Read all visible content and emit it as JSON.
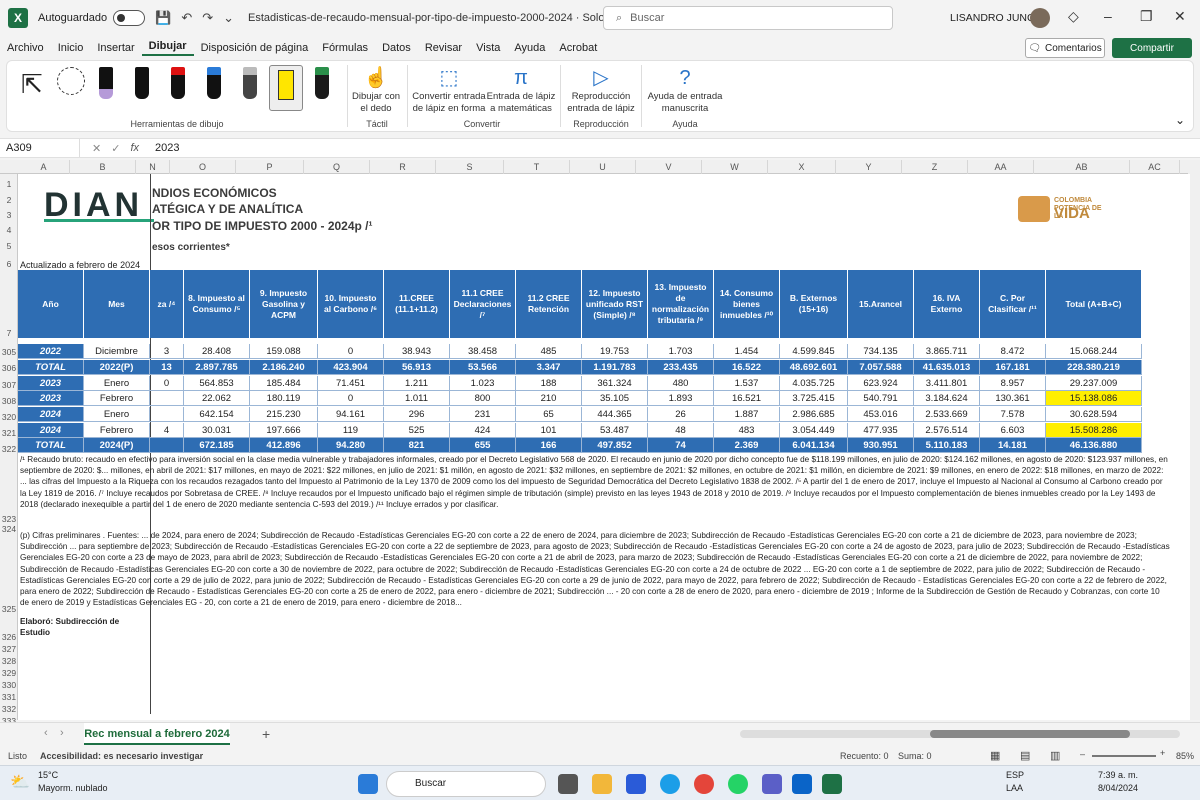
{
  "window": {
    "app_letter": "X",
    "autosave_label": "Autoguardado",
    "filename": "Estadisticas-de-recaudo-mensual-por-tipo-de-impuesto-2000-2024 · Solo lec...",
    "search_placeholder": "Buscar",
    "user": "LISANDRO JUNCO"
  },
  "menu": [
    "Archivo",
    "Inicio",
    "Insertar",
    "Dibujar",
    "Disposición de página",
    "Fórmulas",
    "Datos",
    "Revisar",
    "Vista",
    "Ayuda",
    "Acrobat"
  ],
  "menu_active": "Dibujar",
  "buttons": {
    "comments": "Comentarios",
    "share": "Compartir"
  },
  "ribbon": {
    "group_tools": "Herramientas de dibujo",
    "draw_finger": "Dibujar con el dedo",
    "group_touch": "Táctil",
    "ink_to_shape": "Convertir entrada de lápiz en forma",
    "ink_to_math": "Entrada de lápiz a matemáticas",
    "group_convert": "Convertir",
    "replay": "Reproducción entrada de lápiz",
    "group_replay": "Reproducción",
    "help_ink": "Ayuda de entrada manuscrita",
    "group_help": "Ayuda"
  },
  "formula": {
    "cell": "A309",
    "value": "2023",
    "fx": "fx"
  },
  "columns": [
    "A",
    "B",
    "N",
    "O",
    "P",
    "Q",
    "R",
    "S",
    "T",
    "U",
    "V",
    "W",
    "X",
    "Y",
    "Z",
    "AA",
    "AB",
    "AC"
  ],
  "rows": [
    "1",
    "2",
    "3",
    "4",
    "5",
    "6",
    "7",
    "305",
    "306",
    "307",
    "308",
    "320",
    "321",
    "322",
    "323",
    "324",
    "325",
    "326",
    "327",
    "328",
    "329",
    "330",
    "331",
    "332",
    "333"
  ],
  "sheet": {
    "logo_text": "DIAN",
    "title1": "NDIOS ECONÓMICOS",
    "title2": "ATÉGICA Y DE ANALÍTICA",
    "title3": "OR TIPO DE IMPUESTO 2000 - 2024p /¹",
    "subtitle": "esos corrientes*",
    "updated": "Actualizado a febrero de 2024",
    "brand_small": "COLOMBIA POTENCIA DE LA",
    "brand_big": "VIDA"
  },
  "table": {
    "headers": [
      "Año",
      "Mes",
      "za /⁴",
      "8. Impuesto al Consumo /⁵",
      "9. Impuesto Gasolina y ACPM",
      "10. Impuesto al Carbono /⁶",
      "11.CREE (11.1+11.2)",
      "11.1 CREE Declaraciones /⁷",
      "11.2 CREE Retención",
      "12. Impuesto unificado RST (Simple) /⁸",
      "13. Impuesto de normalización tributaria /⁹",
      "14. Consumo bienes inmuebles /¹⁰",
      "B. Externos (15+16)",
      "15.Arancel",
      "16. IVA Externo",
      "C. Por Clasificar /¹¹",
      "Total (A+B+C)"
    ],
    "rows": [
      {
        "style": "white",
        "cells": [
          "2022",
          "Diciembre",
          "3",
          "28.408",
          "159.088",
          "0",
          "38.943",
          "38.458",
          "485",
          "19.753",
          "1.703",
          "1.454",
          "4.599.845",
          "734.135",
          "3.865.711",
          "8.472",
          "15.068.244"
        ]
      },
      {
        "style": "blue",
        "cells": [
          "TOTAL",
          "2022(P)",
          "13",
          "2.897.785",
          "2.186.240",
          "423.904",
          "56.913",
          "53.566",
          "3.347",
          "1.191.783",
          "233.435",
          "16.522",
          "48.692.601",
          "7.057.588",
          "41.635.013",
          "167.181",
          "228.380.219"
        ]
      },
      {
        "style": "white",
        "cells": [
          "2023",
          "Enero",
          "0",
          "564.853",
          "185.484",
          "71.451",
          "1.211",
          "1.023",
          "188",
          "361.324",
          "480",
          "1.537",
          "4.035.725",
          "623.924",
          "3.411.801",
          "8.957",
          "29.237.009"
        ]
      },
      {
        "style": "white",
        "cells": [
          "2023",
          "Febrero",
          "",
          "22.062",
          "180.119",
          "0",
          "1.011",
          "800",
          "210",
          "35.105",
          "1.893",
          "16.521",
          "3.725.415",
          "540.791",
          "3.184.624",
          "130.361",
          "15.138.086"
        ],
        "highlight_last": true
      },
      {
        "style": "white",
        "cells": [
          "2024",
          "Enero",
          "",
          "642.154",
          "215.230",
          "94.161",
          "296",
          "231",
          "65",
          "444.365",
          "26",
          "1.887",
          "2.986.685",
          "453.016",
          "2.533.669",
          "7.578",
          "30.628.594"
        ]
      },
      {
        "style": "white",
        "cells": [
          "2024",
          "Febrero",
          "4",
          "30.031",
          "197.666",
          "119",
          "525",
          "424",
          "101",
          "53.487",
          "48",
          "483",
          "3.054.449",
          "477.935",
          "2.576.514",
          "6.603",
          "15.508.286"
        ],
        "highlight_last": true
      },
      {
        "style": "blue",
        "cells": [
          "TOTAL",
          "2024(P)",
          "",
          "672.185",
          "412.896",
          "94.280",
          "821",
          "655",
          "166",
          "497.852",
          "74",
          "2.369",
          "6.041.134",
          "930.951",
          "5.110.183",
          "14.181",
          "46.136.880"
        ]
      }
    ]
  },
  "notes": {
    "n1": "/¹ Recaudo bruto: recaudo en efectivo para inversión social en la clase media vulnerable y trabajadores informales, creado por el Decreto Legislativo 568 de 2020. El recaudo en junio de 2020 por dicho concepto fue de $118.199 millones, en julio de 2020: $124.162 millones, en agosto de 2020: $123.937 millones, en septiembre de 2020: $... millones, en abril de 2021: $17 millones, en mayo de 2021: $22 millones, en julio de 2021: $1 millón, en agosto de 2021: $32 millones, en septiembre de 2021: $2 millones, en octubre de 2021: $1 millón, en diciembre de 2021: $9 millones, en enero de 2022: $18 millones, en marzo de 2022: ... las cifras del Impuesto a la Riqueza con los recaudos rezagados tanto del Impuesto al Patrimonio de la Ley 1370 de 2009 como los del impuesto de Seguridad Democrática del Decreto Legislativo 1838 de 2002. /⁵ A partir del 1 de enero de 2017, incluye el Impuesto al Nacional al Consumo al Carbono creado por la Ley 1819 de 2016. /⁷ Incluye recaudos por Sobretasa de CREE. /⁸ Incluye recaudos por el Impuesto unificado bajo el régimen simple de tributación (simple) previsto en las leyes 1943 de 2018 y 2010 de 2019. /⁹ Incluye recaudos por el Impuesto complementación de bienes inmuebles creado por la Ley 1493 de 2018 (declarado inexequible a partir del 1 de enero de 2020 mediante sentencia C-593 del 2019.) /¹¹ Incluye errados y por clasificar.",
    "n2": "(p) Cifras preliminares . Fuentes: ... de 2024, para enero de 2024; Subdirección de Recaudo -Estadísticas Gerenciales EG-20 con corte a 22 de enero de 2024, para diciembre de 2023; Subdirección de Recaudo -Estadísticas Gerenciales EG-20 con corte a 21 de diciembre de 2023, para noviembre de 2023; Subdirección ... para septiembre de 2023; Subdirección de Recaudo -Estadísticas Gerenciales EG-20 con corte a 22 de septiembre de 2023, para agosto de 2023; Subdirección de Recaudo -Estadísticas Gerenciales EG-20 con corte a 24 de agosto de 2023, para julio de 2023; Subdirección de Recaudo -Estadísticas Gerenciales EG-20 con corte a 23 de mayo de 2023, para abril de 2023; Subdirección de Recaudo -Estadísticas Gerenciales EG-20 con corte a 21 de abril de 2023, para marzo de 2023; Subdirección de Recaudo -Estadísticas Gerenciales EG-20 con corte a 21 de diciembre de 2022, para noviembre de 2022; Subdirección de Recaudo -Estadísticas Gerenciales EG-20 con corte a 30 de noviembre de 2022, para octubre de 2022; Subdirección de Recaudo -Estadísticas Gerenciales EG-20 con corte a 24 de octubre de 2022 ... EG-20 con corte a 1 de septiembre de 2022, para julio de 2022; Subdirección de Recaudo - Estadísticas Gerenciales EG-20 con corte a 29 de julio de 2022, para junio de 2022; Subdirección de Recaudo - Estadísticas Gerenciales EG-20 con corte a 29 de junio de 2022, para mayo de 2022, para febrero de 2022; Subdirección de Recaudo - Estadísticas Gerenciales EG-20 con corte a 22 de febrero de 2022, para enero de 2022; Subdirección de Recaudo - Estadísticas Gerenciales EG-20 con corte a 25 de enero de 2022, para enero - diciembre de 2021; Subdirección ... - 20 con corte a 28 de enero de 2020, para enero - diciembre de 2019 ; Informe de la Subdirección de Gestión de Recaudo y Cobranzas, con corte 10 de enero de 2019 y Estadísticas Gerenciales EG - 20, con corte a 21 de enero de 2019, para enero - diciembre de 2018...",
    "n3": "Elaboró: Subdirección de Estudio"
  },
  "tabs": {
    "sheet": "Rec mensual a febrero 2024"
  },
  "status": {
    "ready": "Listo",
    "access": "Accesibilidad: es necesario investigar",
    "count": "Recuento: 0",
    "sum": "Suma: 0",
    "zoom": "85%"
  },
  "taskbar": {
    "temp": "15°C",
    "weather": "Mayorm. nublado",
    "search": "Buscar",
    "lang1": "ESP",
    "lang2": "LAA",
    "time": "7:39 a. m.",
    "date": "8/04/2024"
  }
}
